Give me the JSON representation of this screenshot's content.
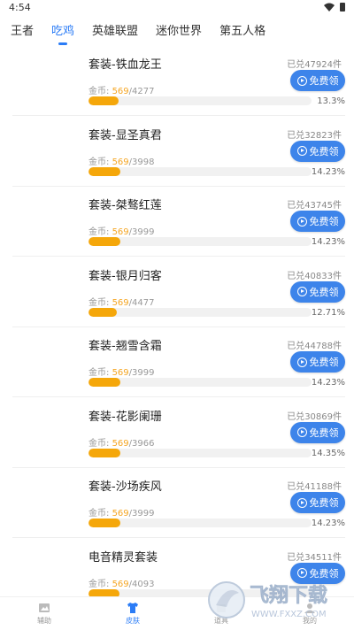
{
  "status": {
    "time": "4:54"
  },
  "tabs": [
    {
      "label": "王者",
      "active": false
    },
    {
      "label": "吃鸡",
      "active": true
    },
    {
      "label": "英雄联盟",
      "active": false
    },
    {
      "label": "迷你世界",
      "active": false
    },
    {
      "label": "第五人格",
      "active": false
    }
  ],
  "labels": {
    "sold_prefix": "已兑",
    "sold_suffix": "件",
    "coin_prefix": "金币: ",
    "free_button": "免费领"
  },
  "items": [
    {
      "title": "套装-铁血龙王",
      "sold": "47924",
      "have": "569",
      "need": "/4277",
      "percent": "13.3%",
      "progress": 0.133
    },
    {
      "title": "套装-显圣真君",
      "sold": "32823",
      "have": "569",
      "need": "/3998",
      "percent": "14.23%",
      "progress": 0.1423
    },
    {
      "title": "套装-桀骜红莲",
      "sold": "43745",
      "have": "569",
      "need": "/3999",
      "percent": "14.23%",
      "progress": 0.1423
    },
    {
      "title": "套装-银月归客",
      "sold": "40833",
      "have": "569",
      "need": "/4477",
      "percent": "12.71%",
      "progress": 0.1271
    },
    {
      "title": "套装-翘雪含霜",
      "sold": "44788",
      "have": "569",
      "need": "/3999",
      "percent": "14.23%",
      "progress": 0.1423
    },
    {
      "title": "套装-花影阑珊",
      "sold": "30869",
      "have": "569",
      "need": "/3966",
      "percent": "14.35%",
      "progress": 0.1435
    },
    {
      "title": "套装-沙场疾风",
      "sold": "41188",
      "have": "569",
      "need": "/3999",
      "percent": "14.23%",
      "progress": 0.1423
    },
    {
      "title": "电音精灵套装",
      "sold": "34511",
      "have": "569",
      "need": "/4093",
      "percent": "",
      "progress": 0.139
    }
  ],
  "bottom_nav": [
    {
      "label": "辅助",
      "icon": "image-icon",
      "active": false
    },
    {
      "label": "皮肤",
      "icon": "shirt-icon",
      "active": true
    },
    {
      "label": "道具",
      "icon": "box-icon",
      "active": false
    },
    {
      "label": "我的",
      "icon": "user-icon",
      "active": false
    }
  ],
  "watermark": {
    "text": "飞翔下载",
    "url_text": "WWW.FXXZ.COM"
  },
  "colors": {
    "accent": "#2b7cf6",
    "button": "#3d84ea",
    "progress": "#f5a70a",
    "coin": "#f5a623"
  }
}
